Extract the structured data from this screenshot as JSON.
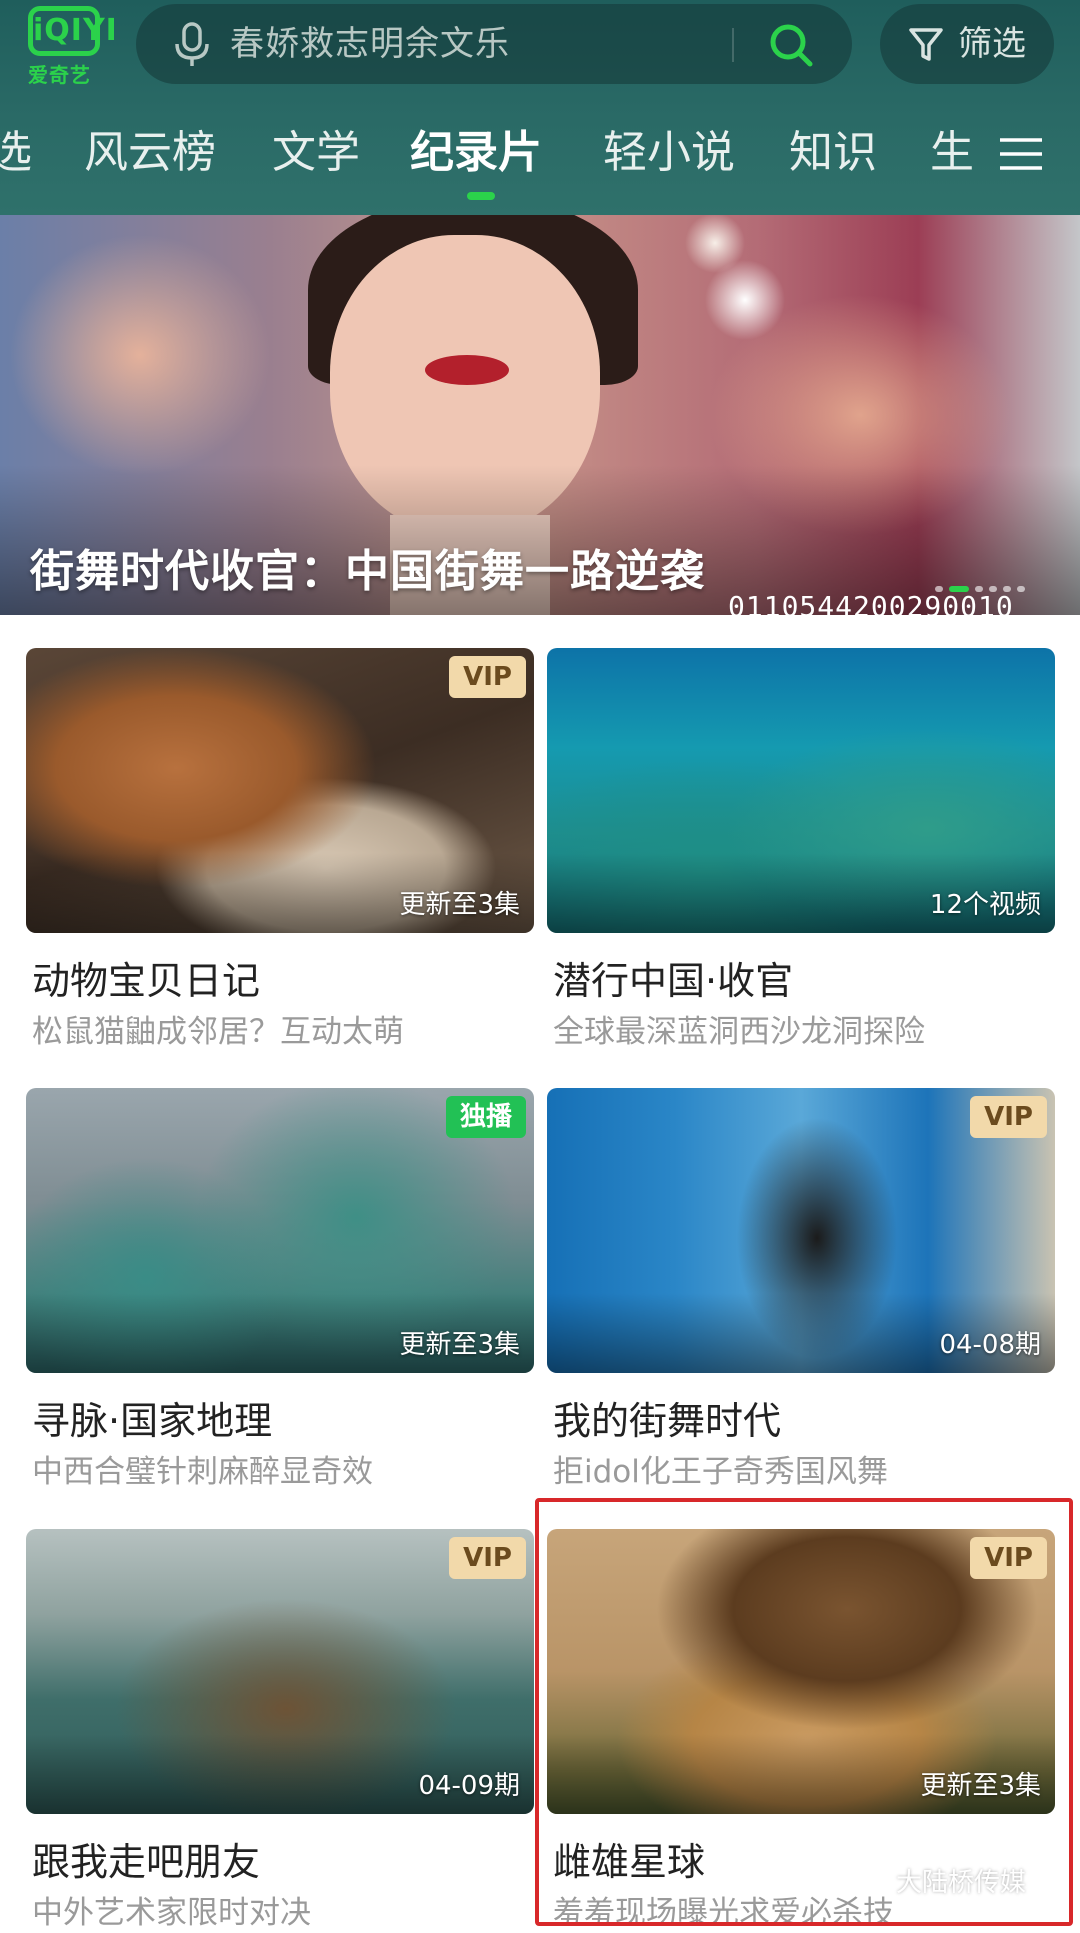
{
  "app": {
    "logo_mark": "iQIYI",
    "logo_text": "爱奇艺"
  },
  "search": {
    "placeholder": "春娇救志明余文乐"
  },
  "filter": {
    "label": "筛选"
  },
  "tabs": [
    {
      "label": "选"
    },
    {
      "label": "风云榜"
    },
    {
      "label": "文学"
    },
    {
      "label": "纪录片",
      "active": true
    },
    {
      "label": "轻小说"
    },
    {
      "label": "知识"
    },
    {
      "label": "生"
    }
  ],
  "banner": {
    "title": "街舞时代收官：中国街舞一路逆袭",
    "code": "0110544200290010"
  },
  "cards": [
    {
      "title": "动物宝贝日记",
      "subtitle": "松鼠猫鼬成邻居？互动太萌",
      "badge": "VIP",
      "episode": "更新至3集"
    },
    {
      "title": "潜行中国·收官",
      "subtitle": "全球最深蓝洞西沙龙洞探险",
      "badge": "",
      "episode": "12个视频"
    },
    {
      "title": "寻脉·国家地理",
      "subtitle": "中西合璧针刺麻醉显奇效",
      "badge": "独播",
      "episode": "更新至3集"
    },
    {
      "title": "我的街舞时代",
      "subtitle": "拒idol化王子奇秀国风舞",
      "badge": "VIP",
      "episode": "04-08期"
    },
    {
      "title": "跟我走吧朋友",
      "subtitle": "中外艺术家限时对决",
      "badge": "VIP",
      "episode": "04-09期"
    },
    {
      "title": "雌雄星球",
      "subtitle": "羞羞现场曝光求爱必杀技",
      "badge": "VIP",
      "episode": "更新至3集"
    }
  ],
  "watermark": {
    "text": "大陆桥传媒"
  },
  "colors": {
    "header_bg": "#2a6a66",
    "accent_green": "#2bd24b",
    "vip_badge": "#f2d9aa",
    "exclusive_badge": "#22c155",
    "highlight_red": "#d8282a"
  }
}
